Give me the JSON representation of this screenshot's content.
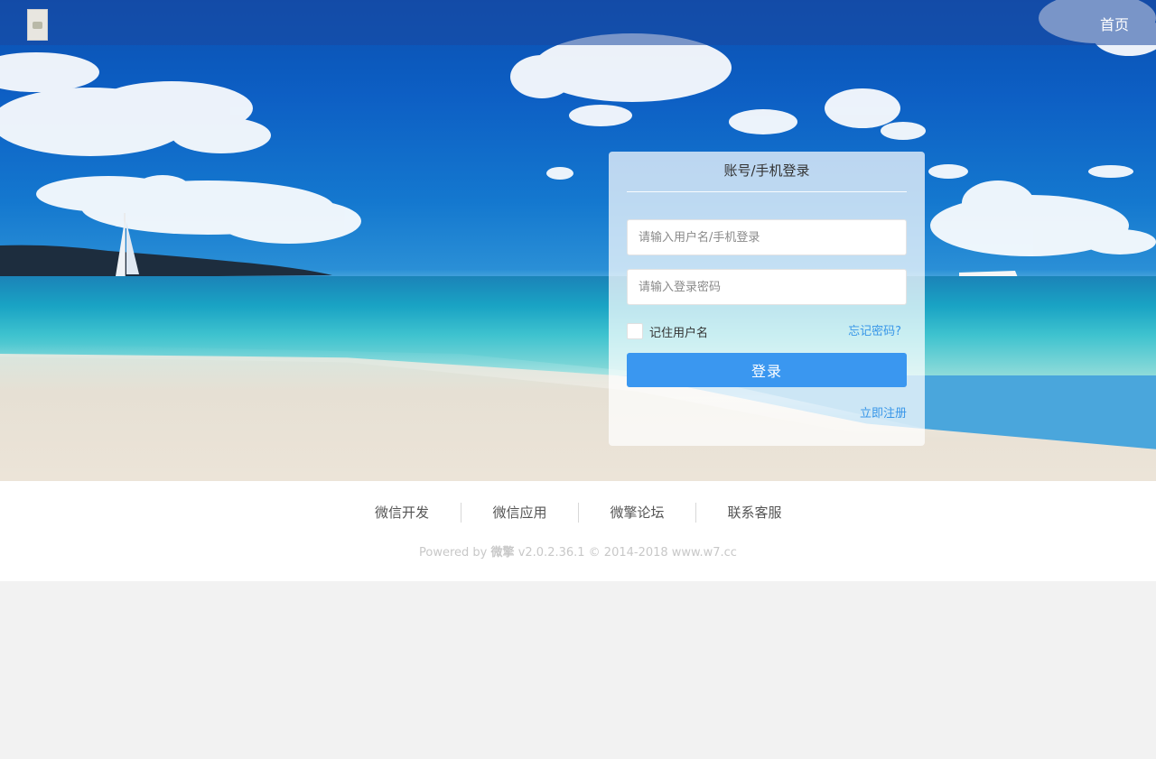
{
  "nav": {
    "logo": "logo",
    "home": "首页"
  },
  "login": {
    "title": "账号/手机登录",
    "username_placeholder": "请输入用户名/手机登录",
    "password_placeholder": "请输入登录密码",
    "remember_label": "记住用户名",
    "forgot_label": "忘记密码?",
    "submit_label": "登录",
    "register_label": "立即注册"
  },
  "footer": {
    "links": [
      "微信开发",
      "微信应用",
      "微擎论坛",
      "联系客服"
    ],
    "powered_prefix": "Powered by",
    "powered_brand": "微擎",
    "powered_suffix": "v2.0.2.36.1 © 2014-2018 www.w7.cc"
  },
  "colors": {
    "accent": "#3a97f0",
    "link": "#3896e8",
    "topbar": "#1c48a0"
  }
}
